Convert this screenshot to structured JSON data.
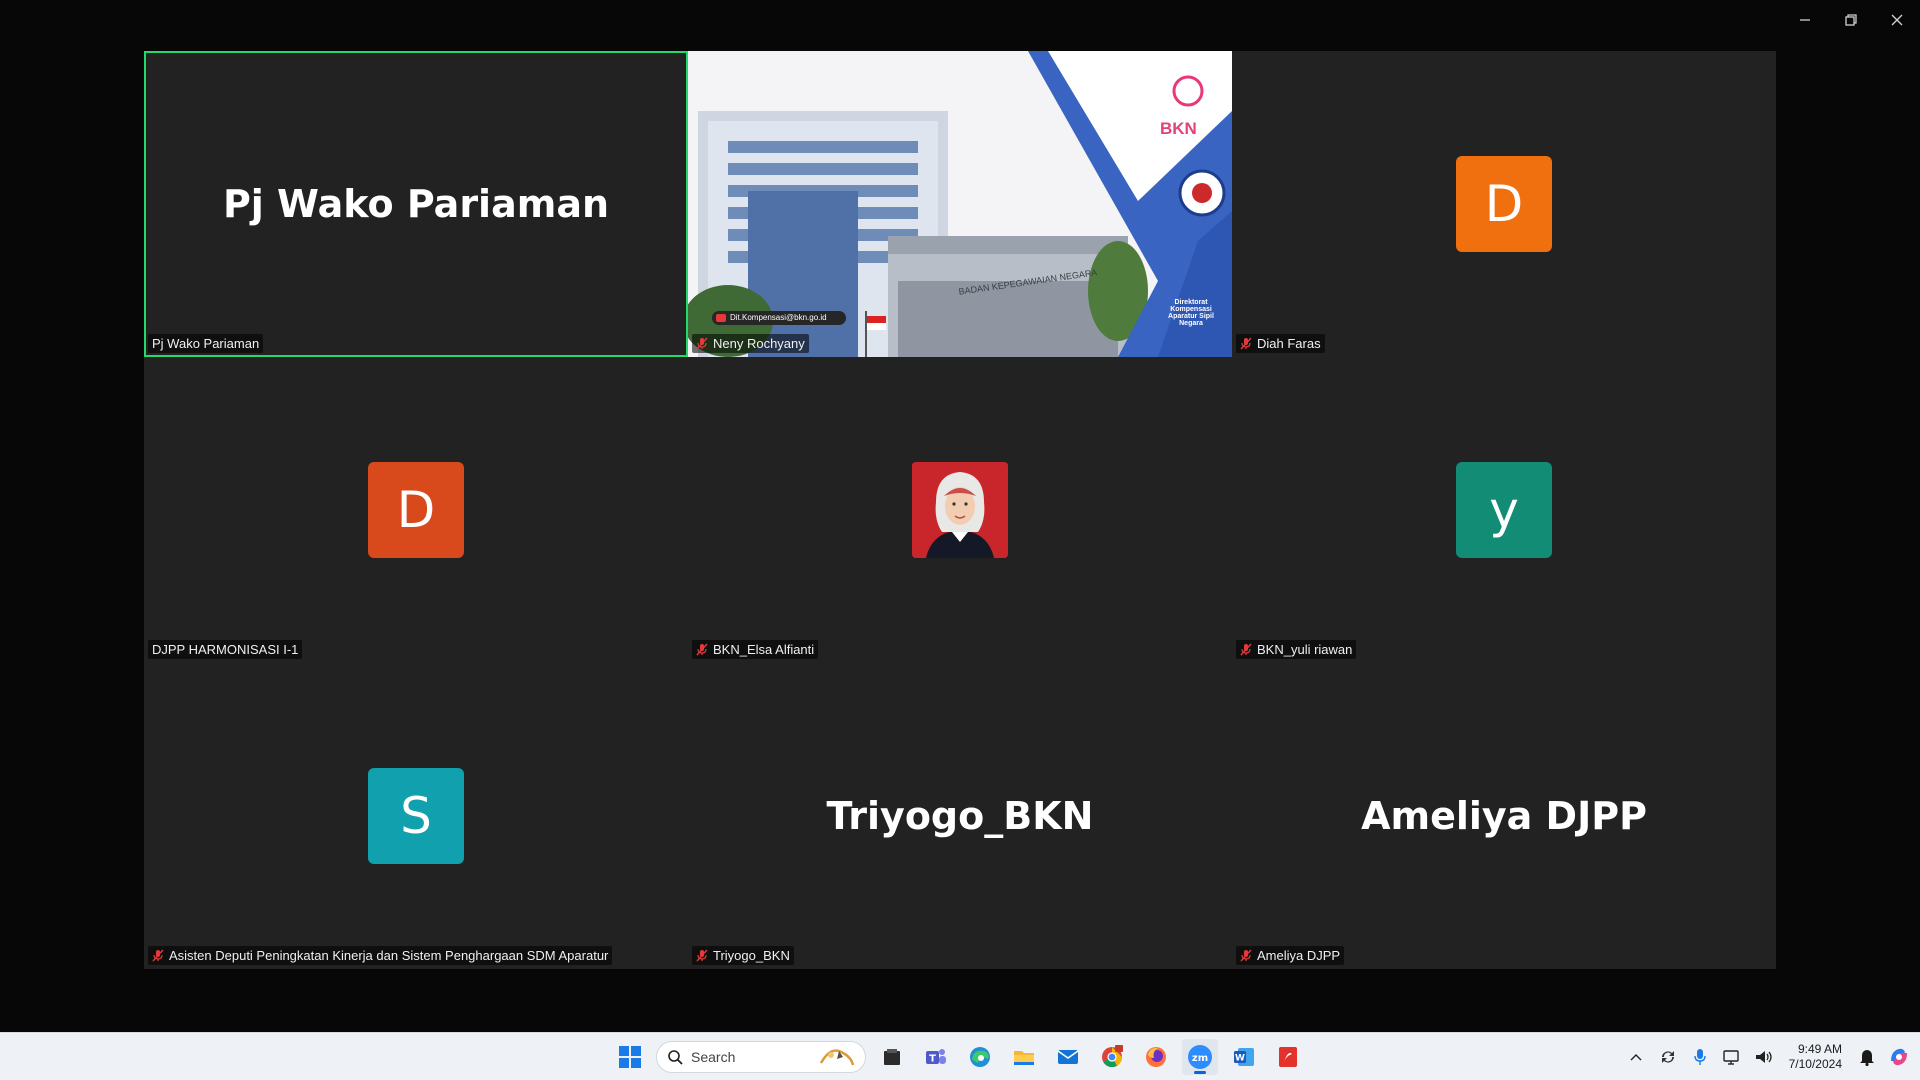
{
  "window": {
    "minimize_icon": "minimize-icon",
    "restore_icon": "restore-icon",
    "close_icon": "close-icon"
  },
  "tiles": [
    {
      "big_name": "Pj Wako Pariaman",
      "label": "Pj Wako Pariaman",
      "muted": false,
      "active": true
    },
    {
      "video": true,
      "label": "Neny Rochyany",
      "muted": true,
      "video_text": {
        "bkn": "BKN",
        "building_sign": "BADAN KEPEGAWAIAN NEGARA",
        "email": "Dit.Kompensasi@bkn.go.id",
        "directorate": "Direktorat Kompensasi Aparatur Sipil Negara"
      }
    },
    {
      "avatar_letter": "D",
      "avatar_color": "#f0700f",
      "label": "Diah Faras",
      "muted": true
    },
    {
      "avatar_letter": "D",
      "avatar_color": "#d84a1c",
      "label": "DJPP HARMONISASI I-1",
      "muted": false
    },
    {
      "photo": true,
      "label": "BKN_Elsa Alfianti",
      "muted": true
    },
    {
      "avatar_letter": "y",
      "avatar_color": "#138c76",
      "label": "BKN_yuli riawan",
      "muted": true
    },
    {
      "avatar_letter": "S",
      "avatar_color": "#10a0ae",
      "label": "Asisten Deputi Peningkatan Kinerja dan Sistem Penghargaan SDM Aparatur",
      "muted": true
    },
    {
      "big_name": "Triyogo_BKN",
      "label": "Triyogo_BKN",
      "muted": true
    },
    {
      "big_name": "Ameliya DJPP",
      "label": "Ameliya DJPP",
      "muted": true
    }
  ],
  "taskbar": {
    "search_placeholder": "Search",
    "apps": [
      "windows-start-icon",
      "file-manager-icon",
      "teams-icon",
      "edge-icon",
      "file-explorer-icon",
      "mail-icon",
      "chrome-icon",
      "firefox-icon",
      "zoom-icon",
      "word-icon",
      "pdf-icon"
    ],
    "time": "9:49 AM",
    "date": "7/10/2024"
  },
  "colors": {
    "active_border": "#23d96e",
    "tile_bg": "#222222",
    "gallery_bg": "#1e1e1e"
  }
}
